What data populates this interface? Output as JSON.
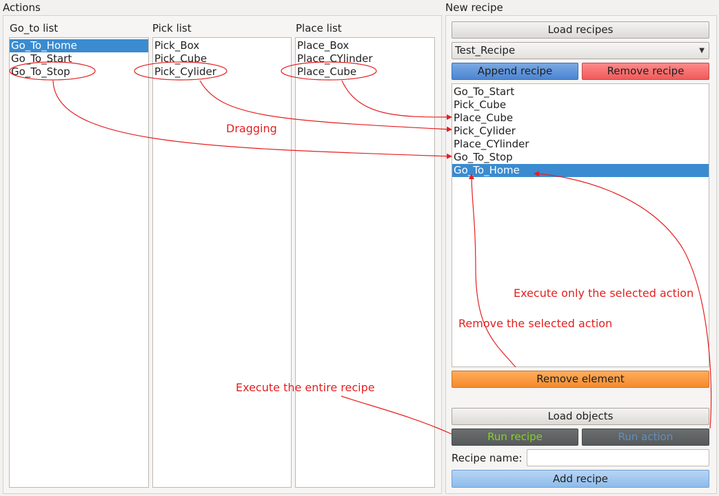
{
  "actions": {
    "title": "Actions",
    "goto": {
      "title": "Go_to list",
      "items": [
        "Go_To_Home",
        "Go_To_Start",
        "Go_To_Stop"
      ],
      "selected": 0
    },
    "pick": {
      "title": "Pick list",
      "items": [
        "Pick_Box",
        "Pick_Cube",
        "Pick_Cylider"
      ]
    },
    "place": {
      "title": "Place list",
      "items": [
        "Place_Box",
        "Place_CYlinder",
        "Place_Cube"
      ]
    }
  },
  "recipe": {
    "title": "New recipe",
    "load_recipes_label": "Load recipes",
    "selected_recipe": "Test_Recipe",
    "append_label": "Append recipe",
    "remove_recipe_label": "Remove recipe",
    "items": [
      "Go_To_Start",
      "Pick_Cube",
      "Place_Cube",
      "Pick_Cylider",
      "Place_CYlinder",
      "Go_To_Stop",
      "Go_To_Home"
    ],
    "selected": 6,
    "remove_element_label": "Remove element",
    "load_objects_label": "Load objects",
    "run_recipe_label": "Run recipe",
    "run_action_label": "Run action",
    "recipe_name_label": "Recipe name:",
    "recipe_name_value": "",
    "add_recipe_label": "Add recipe"
  },
  "annotations": {
    "dragging": "Dragging",
    "execute_selected": "Execute only the selected action",
    "remove_selected": "Remove the selected action",
    "execute_entire": "Execute the entire recipe"
  },
  "colors": {
    "selection": "#3a8bd0",
    "annotation": "#e51f1f",
    "run_recipe_text": "#86d12a",
    "run_action_text": "#5d8fc6"
  }
}
